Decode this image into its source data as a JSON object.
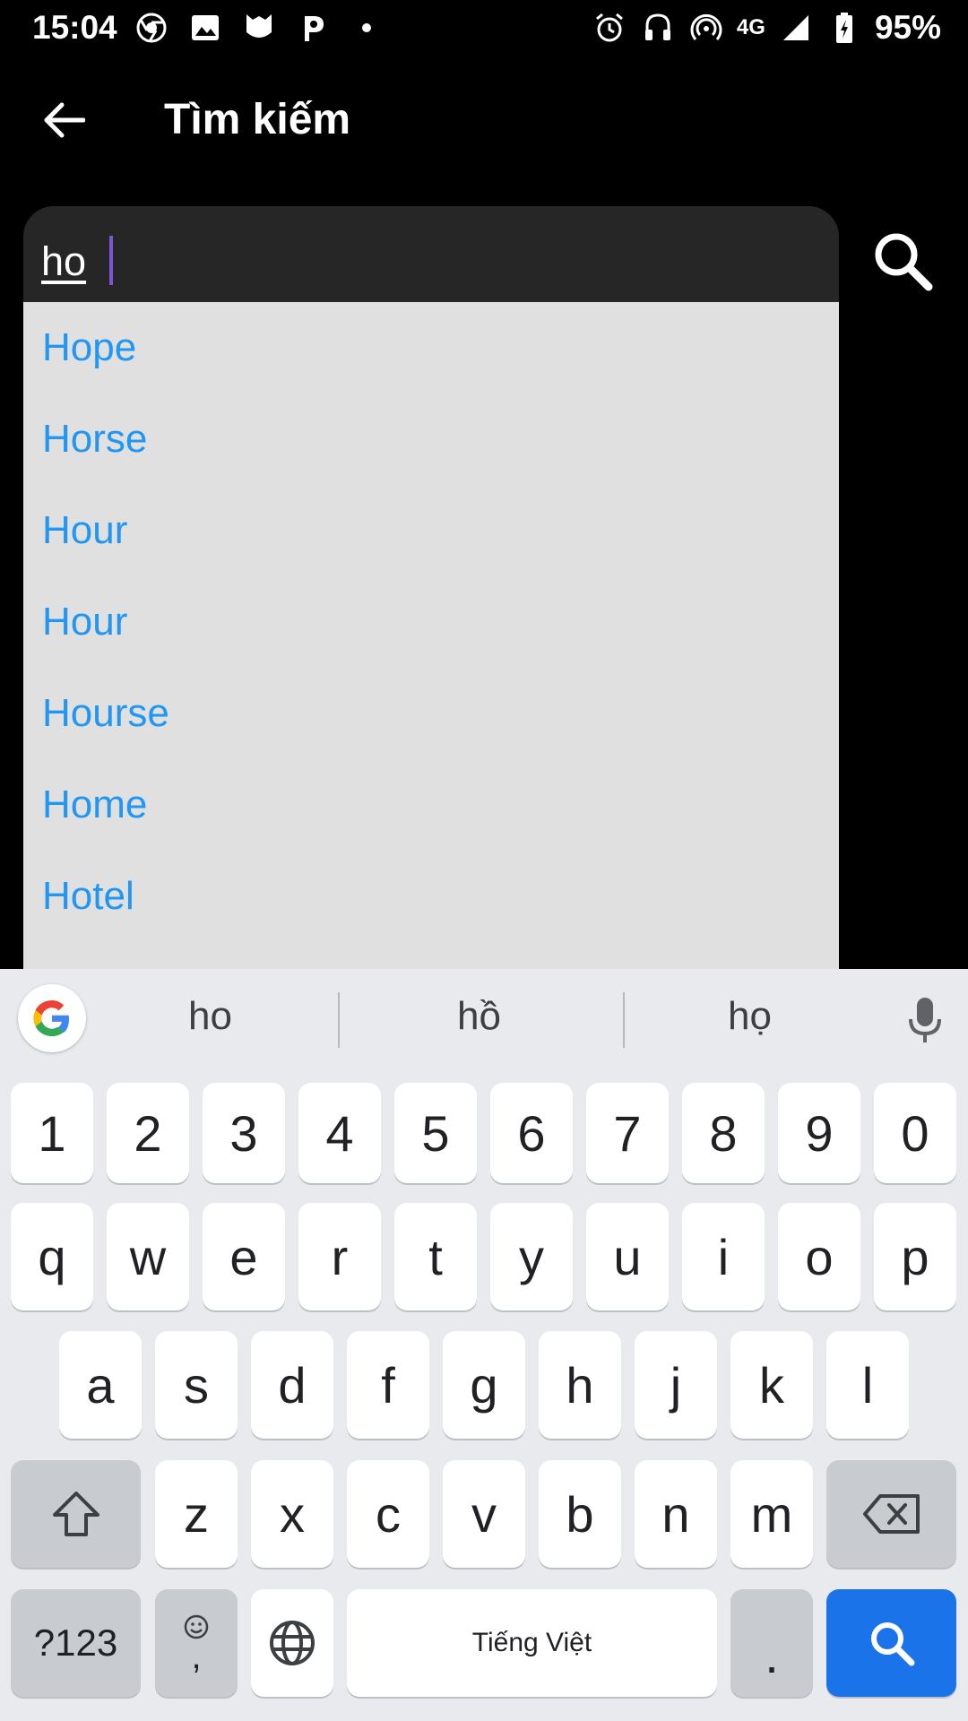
{
  "status_bar": {
    "time": "15:04",
    "network": "4G",
    "battery": "95%",
    "left_icons": [
      "chrome-icon",
      "gallery-icon",
      "shield-app-icon",
      "p-app-icon",
      "dot-icon"
    ],
    "right_icons": [
      "alarm-icon",
      "headset-icon",
      "hotspot-icon",
      "signal-icon",
      "battery-icon"
    ]
  },
  "app_bar": {
    "title": "Tìm kiếm"
  },
  "search": {
    "value": "ho"
  },
  "suggestions": [
    "Hope",
    "Horse",
    "Hour",
    "Hour",
    "Hourse",
    "Home",
    "Hotel"
  ],
  "keyboard": {
    "suggestions": [
      "ho",
      "hồ",
      "họ"
    ],
    "row_numbers": [
      "1",
      "2",
      "3",
      "4",
      "5",
      "6",
      "7",
      "8",
      "9",
      "0"
    ],
    "row1": [
      "q",
      "w",
      "e",
      "r",
      "t",
      "y",
      "u",
      "i",
      "o",
      "p"
    ],
    "row2": [
      "a",
      "s",
      "d",
      "f",
      "g",
      "h",
      "j",
      "k",
      "l"
    ],
    "row3": [
      "z",
      "x",
      "c",
      "v",
      "b",
      "n",
      "m"
    ],
    "symbols_label": "?123",
    "comma_label": ",",
    "space_label": "Tiếng Việt",
    "period_label": ".",
    "accent_color": "#1a73e8"
  },
  "colors": {
    "suggestion_text": "#2196f3",
    "suggestion_bg": "#e0e0e0",
    "search_bg": "#262626",
    "caret": "#7b55d8"
  }
}
